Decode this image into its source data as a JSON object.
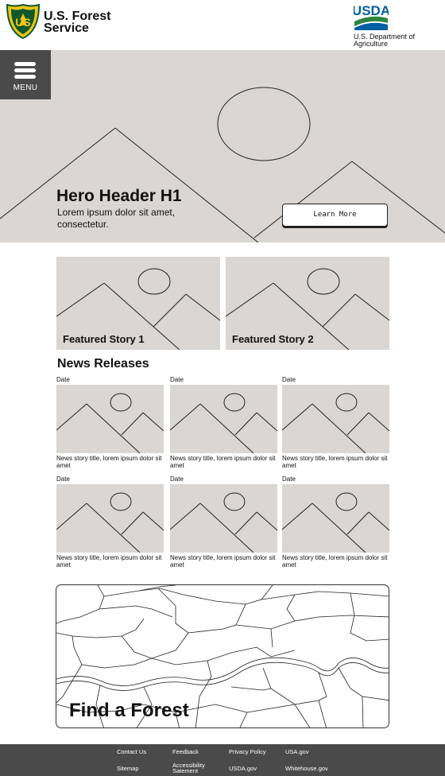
{
  "header": {
    "agency_name": "U.S. Forest Service",
    "usda_wordmark": "USDA",
    "department": "U.S. Department of Agriculture",
    "fs_badge_text": "FOREST SERVICE"
  },
  "colors": {
    "placeholder_gray": "#d9d6d3",
    "dark_gray": "#4a4a4a",
    "fs_green": "#0e5a2c",
    "fs_gold": "#f0c419",
    "usda_blue": "#005ea2",
    "usda_green": "#2e8540"
  },
  "hero": {
    "menu_label": "MENU",
    "title": "Hero Header H1",
    "subtitle": "Lorem ipsum dolor sit amet, consectetur.",
    "cta_label": "Learn More"
  },
  "featured": [
    {
      "label": "Featured Story 1"
    },
    {
      "label": "Featured Story 2"
    }
  ],
  "news": {
    "heading": "News Releases",
    "items": [
      {
        "date": "Date",
        "title": "News story title, lorem ipsum dolor sit amet"
      },
      {
        "date": "Date",
        "title": "News story title, lorem ipsum dolor sit amet"
      },
      {
        "date": "Date",
        "title": "News story title, lorem ipsum dolor sit amet"
      },
      {
        "date": "Date",
        "title": "News story title, lorem ipsum dolor sit amet"
      },
      {
        "date": "Date",
        "title": "News story title, lorem ipsum dolor sit amet"
      },
      {
        "date": "Date",
        "title": "News story title, lorem ipsum dolor sit amet"
      }
    ]
  },
  "map": {
    "title": "Find a Forest"
  },
  "footer": {
    "links": [
      "Contact Us",
      "Feedback",
      "Privacy Policy",
      "USA.gov",
      "Sitemap",
      "Accessibility Satement",
      "USDA.gov",
      "Whitehouse.gov"
    ]
  }
}
